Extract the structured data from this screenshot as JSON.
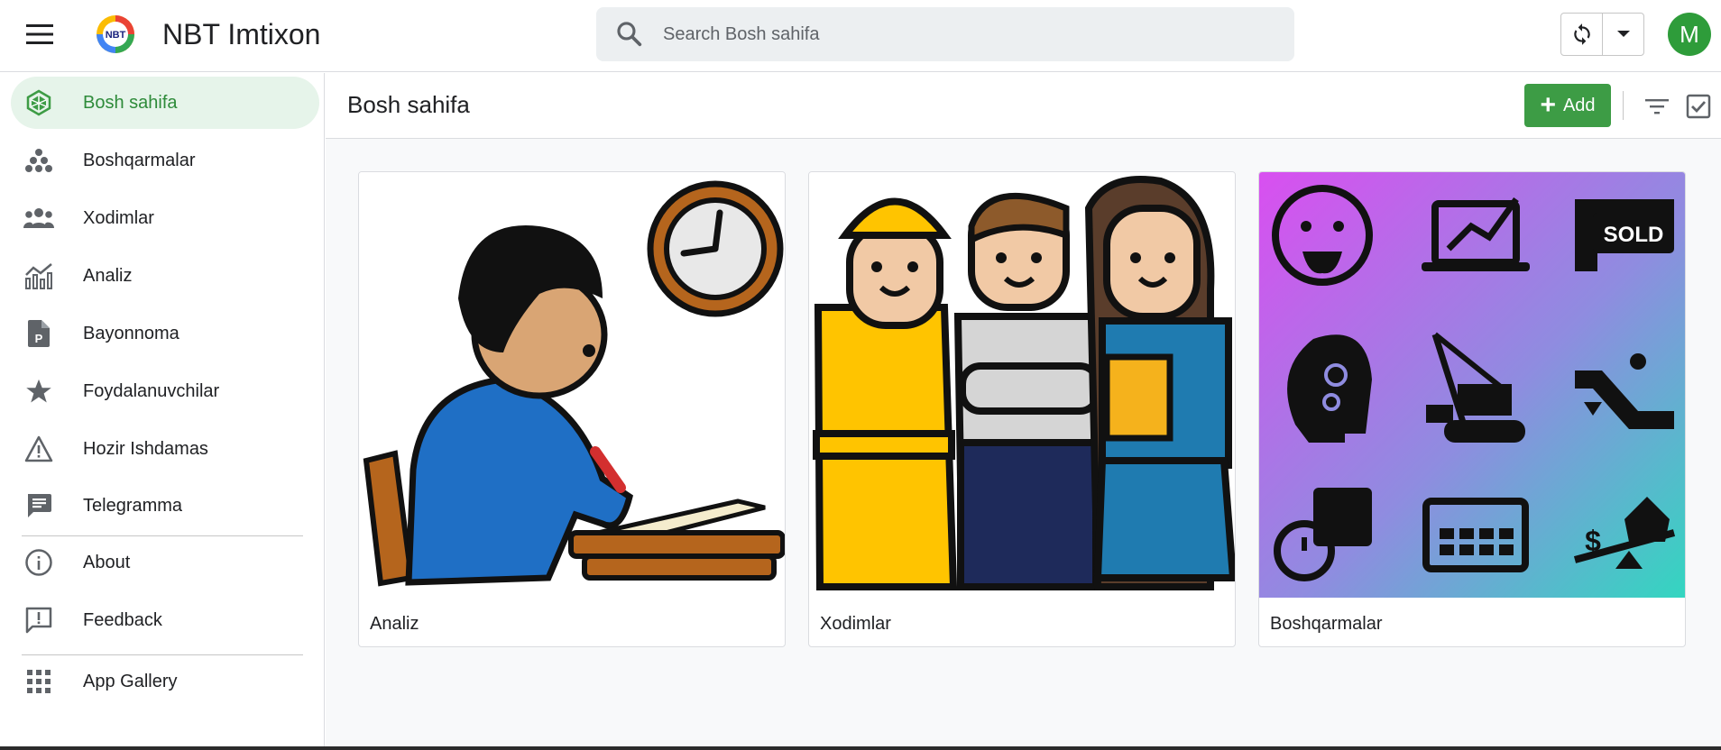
{
  "header": {
    "app_title": "NBT Imtixon",
    "logo_text": "NBT",
    "search_placeholder": "Search Bosh sahifa",
    "avatar_letter": "M",
    "icons": [
      "menu-icon",
      "search-icon",
      "sync-icon",
      "dropdown-arrow-icon"
    ]
  },
  "sidebar": {
    "items": [
      {
        "label": "Bosh sahifa",
        "icon": "home-icon",
        "active": true
      },
      {
        "label": "Boshqarmalar",
        "icon": "group-dots-icon"
      },
      {
        "label": "Xodimlar",
        "icon": "people-icon"
      },
      {
        "label": "Analiz",
        "icon": "analytics-icon"
      },
      {
        "label": "Bayonnoma",
        "icon": "document-p-icon"
      },
      {
        "label": "Foydalanuvchilar",
        "icon": "star-icon"
      },
      {
        "label": "Hozir Ishdamas",
        "icon": "warning-icon"
      },
      {
        "label": "Telegramma",
        "icon": "message-icon"
      }
    ],
    "footer_items": [
      {
        "label": "About",
        "icon": "info-icon"
      },
      {
        "label": "Feedback",
        "icon": "feedback-icon"
      },
      {
        "label": "App Gallery",
        "icon": "grid-icon"
      }
    ]
  },
  "main": {
    "page_title": "Bosh sahifa",
    "add_label": "Add",
    "cards": [
      {
        "label": "Analiz",
        "image": "student-writing-clock-illustration"
      },
      {
        "label": "Xodimlar",
        "image": "three-workers-illustration"
      },
      {
        "label": "Boshqarmalar",
        "image": "business-icons-grid-illustration"
      }
    ],
    "sold_text": "SOLD"
  },
  "colors": {
    "accent": "#3d9c45",
    "active_bg": "#e6f4ea",
    "avatar": "#2e9c3a",
    "search_bg": "#eceff1"
  }
}
